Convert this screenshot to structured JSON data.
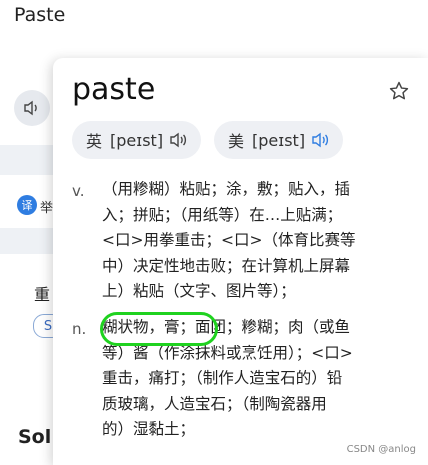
{
  "background": {
    "title": "Paste",
    "fragment": "举",
    "heading_fragment": "重",
    "pill_fragment": "S",
    "bold_fragment": "Sol",
    "translate_icon_text": "译"
  },
  "popup": {
    "word": "paste",
    "phonetics": [
      {
        "label": "英",
        "ipa": "[peɪst]"
      },
      {
        "label": "美",
        "ipa": "[peɪst]"
      }
    ],
    "definitions": [
      {
        "pos": "v.",
        "lines": [
          "（用糁糊）粘贴；涂，敷；贴入，插",
          "入；拼贴；（用纸等）在…上贴满；",
          "<口>用拳重击；<口>（体育比赛等",
          "中）决定性地击败；在计算机上屏幕",
          "上）粘贴（文字、图片等）；"
        ]
      },
      {
        "pos": "n.",
        "lines": [
          "糊状物，膏；面团；糁糊；肉（或鱼",
          "等）酱（作涂抹料或烹饪用）；<口>",
          "重击，痛打；（制作人造宝石的）铅",
          "质玻璃，人造宝石；（制陶瓷器用",
          "的）湿黏土；"
        ]
      }
    ]
  },
  "watermark": "CSDN @anlog",
  "colors": {
    "speaker_active": "#2f7de1",
    "highlight": "#1fd21f"
  },
  "icons": [
    "speaker-icon",
    "star-icon",
    "translate-icon"
  ]
}
